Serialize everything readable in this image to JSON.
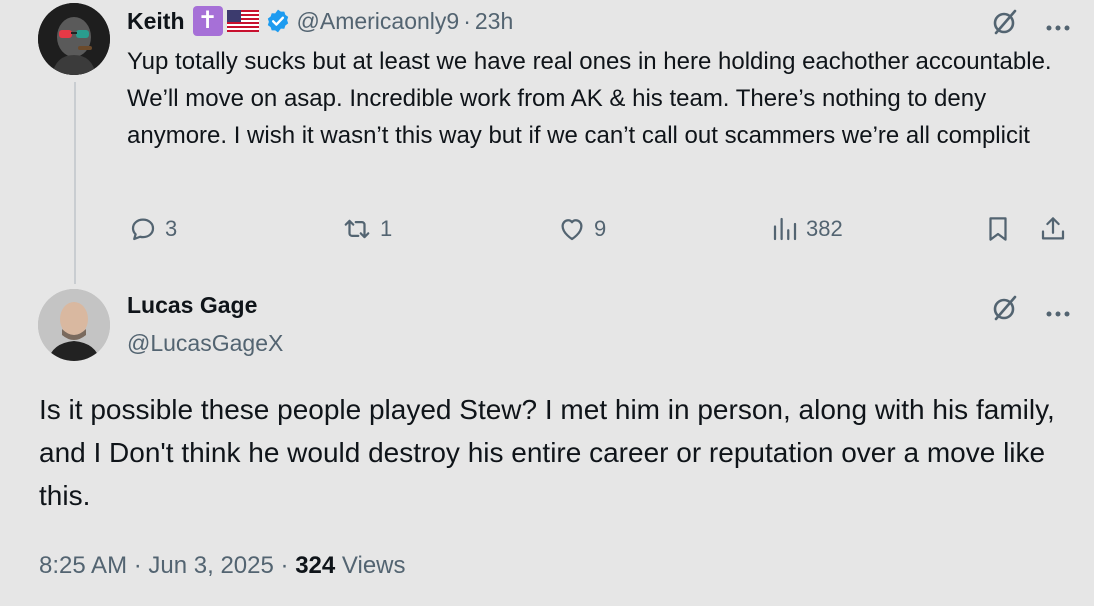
{
  "reply": {
    "name": "Keith",
    "emoji_cross": "✝",
    "handle": "@Americaonly9",
    "separator": "·",
    "time": "23h",
    "text": "Yup totally sucks but at least we have real ones in here holding eachother accountable. We’ll move on asap. Incredible work from AK & his team. There’s nothing to deny anymore. I wish it wasn’t this way but if we can’t call out scammers we’re all complicit",
    "actions": {
      "replies": "3",
      "reposts": "1",
      "likes": "9",
      "views": "382"
    }
  },
  "post": {
    "name": "Lucas Gage",
    "handle": "@LucasGageX",
    "text": "Is it possible these people played Stew? I met him in person, along with his family, and I Don't think he would destroy his entire career or reputation over a move like this.",
    "time": "8:25 AM",
    "sep1": "·",
    "date": "Jun 3, 2025",
    "sep2": "·",
    "views_count": "324",
    "views_label": "Views"
  },
  "icons": {
    "grok": "grok-slash-icon",
    "more": "more-icon",
    "reply": "reply-icon",
    "repost": "repost-icon",
    "like": "like-icon",
    "views": "views-icon",
    "bookmark": "bookmark-icon",
    "share": "share-icon",
    "verified": "verified-badge-icon"
  },
  "colors": {
    "background": "#e6e6e6",
    "text": "#0f1419",
    "secondary": "#536471",
    "verified": "#1d9bf0",
    "cross_emoji": "#a670d7"
  }
}
